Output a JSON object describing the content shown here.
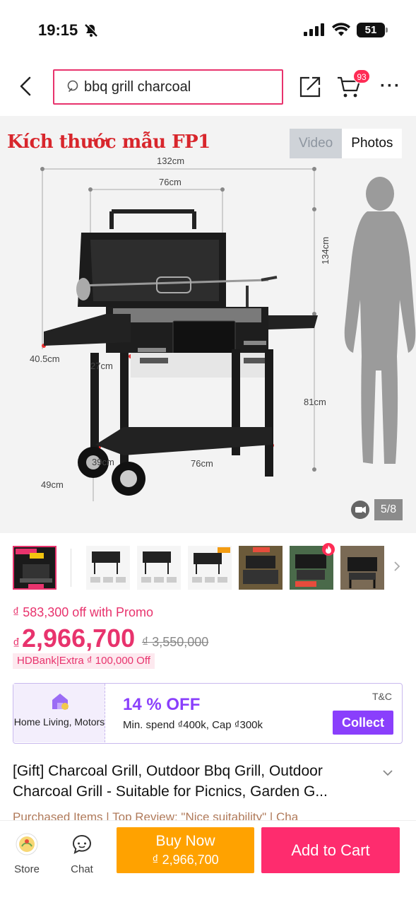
{
  "status_bar": {
    "time": "19:15",
    "battery": "51"
  },
  "header": {
    "search_value": "bbq grill charcoal",
    "cart_count": "93"
  },
  "gallery": {
    "image_caption": "Kích thước mẫu FP1",
    "tabs": {
      "video": "Video",
      "photos": "Photos"
    },
    "active_tab": "Photos",
    "page_indicator": "5/8",
    "dimensions": {
      "overall_width": "132cm",
      "body_width": "76cm",
      "total_height": "134cm",
      "grill_height": "81cm",
      "side_shelf": "40.5cm",
      "side_depth": "27cm",
      "bottom_depth": "39cm",
      "bottom_width": "76cm",
      "wheel_depth": "49cm"
    },
    "thumbnail_badge": "BẾP NƯỚNG BBQ",
    "thumbnail_count": 8
  },
  "pricing": {
    "promo_savings": "₫ 583,300 off with Promo",
    "currency_symbol": "₫",
    "price": "2,966,700",
    "original_price": "₫ 3,550,000",
    "bank_offer": "HDBank|Extra ₫ 100,000 Off"
  },
  "voucher": {
    "category": "Home Living, Motors",
    "discount": "14 % OFF",
    "condition": "Min. spend ₫400k, Cap ₫300k",
    "terms": "T&C",
    "collect_label": "Collect"
  },
  "product": {
    "title_line1": "[Gift] Charcoal Grill, Outdoor Bbq Grill, Outdoor",
    "title_line2": "Charcoal Grill - Suitable for Picnics, Garden G...",
    "meta_text": "Purchased Items  |  Top Review: \"Nice suitability\"  |  Cha"
  },
  "bottom_bar": {
    "store_label": "Store",
    "chat_label": "Chat",
    "buy_now_label": "Buy Now",
    "buy_now_price": "₫ 2,966,700",
    "add_to_cart_label": "Add to Cart"
  },
  "colors": {
    "accent_pink": "#e8336d",
    "voucher_purple": "#8a3ffc",
    "buy_now_orange": "#ffa200",
    "add_cart_pink": "#fe2c6e"
  }
}
